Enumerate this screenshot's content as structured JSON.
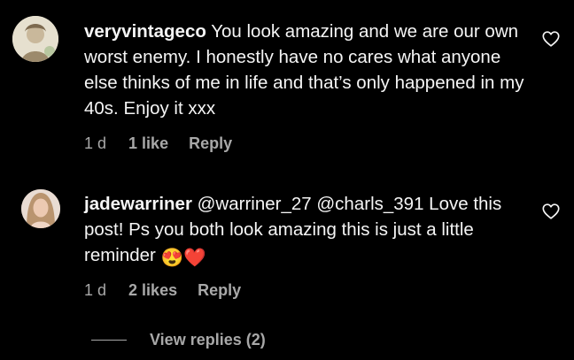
{
  "comments": [
    {
      "username": "veryvintageco",
      "text": "You look amazing and we are our own worst enemy. I honestly have no cares what anyone else thinks of me in life and that’s only happened in my 40s. Enjoy it xxx",
      "time": "1 d",
      "likes": "1 like",
      "reply": "Reply"
    },
    {
      "username": "jadewarriner",
      "text": "@warriner_27 @charls_391 Love this post! Ps you both look amazing this is just a little reminder",
      "emoji": "😍❤️",
      "time": "1 d",
      "likes": "2 likes",
      "reply": "Reply"
    }
  ],
  "view_replies": "View replies (2)",
  "icons": {
    "like": "heart-icon",
    "emoji": [
      "heart-eyes-emoji",
      "red-heart-emoji"
    ]
  },
  "colors": {
    "background": "#000000",
    "text": "#f5f5f5",
    "secondary": "#a8a8a8"
  }
}
